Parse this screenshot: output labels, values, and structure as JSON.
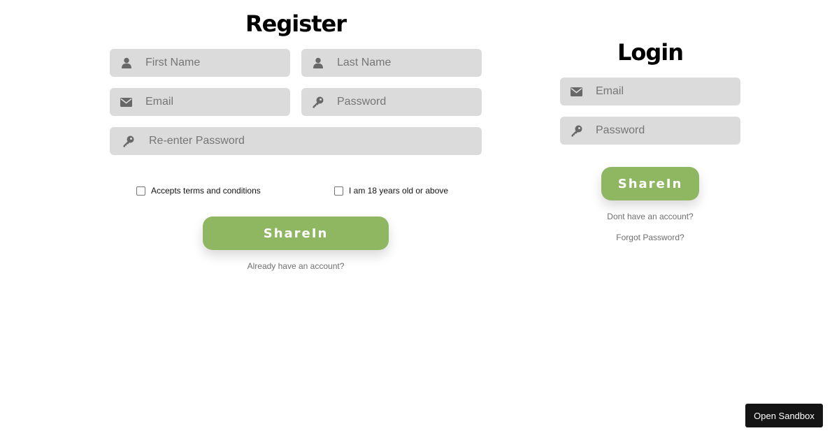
{
  "register": {
    "title": "Register",
    "fields": {
      "first_name": {
        "placeholder": "First Name",
        "value": "",
        "icon": "user-icon"
      },
      "last_name": {
        "placeholder": "Last Name",
        "value": "",
        "icon": "user-icon"
      },
      "email": {
        "placeholder": "Email",
        "value": "",
        "icon": "envelope-icon"
      },
      "password": {
        "placeholder": "Password",
        "value": "",
        "icon": "key-icon"
      },
      "reenter_password": {
        "placeholder": "Re-enter Password",
        "value": "",
        "icon": "key-icon"
      }
    },
    "checkboxes": {
      "terms": {
        "label": "Accepts terms and conditions",
        "checked": false
      },
      "age": {
        "label": "I am 18 years old or above",
        "checked": false
      }
    },
    "submit_label": "ShareIn",
    "login_link": "Already have an account?"
  },
  "login": {
    "title": "Login",
    "fields": {
      "email": {
        "placeholder": "Email",
        "value": "",
        "icon": "envelope-icon"
      },
      "password": {
        "placeholder": "Password",
        "value": "",
        "icon": "key-icon"
      }
    },
    "submit_label": "ShareIn",
    "register_link": "Dont have an account?",
    "forgot_link": "Forgot Password?"
  },
  "sandbox_button": "Open Sandbox",
  "colors": {
    "accent": "#8fb661",
    "field_bg": "#dbdbdb",
    "icon": "#686868"
  }
}
